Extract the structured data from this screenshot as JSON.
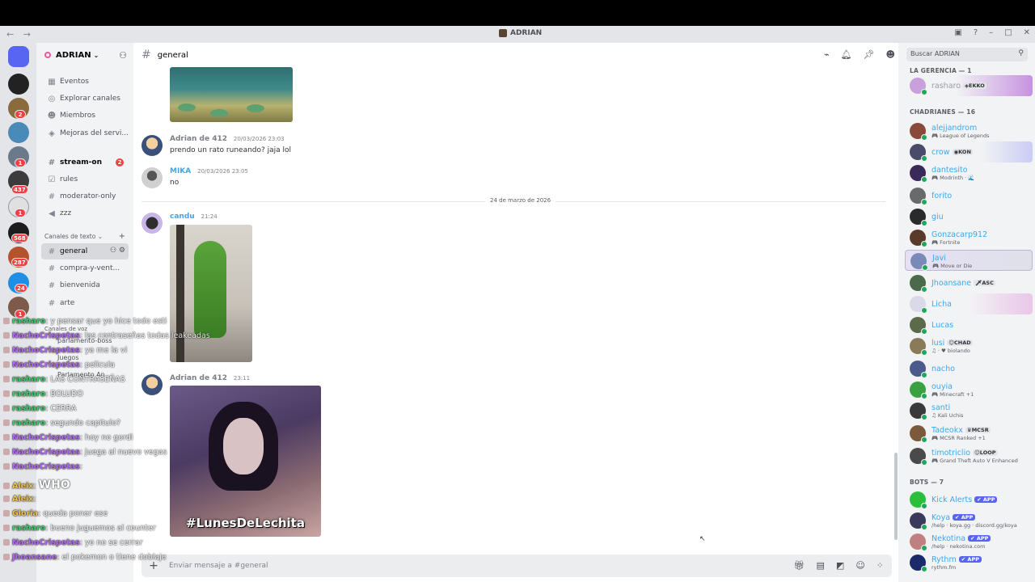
{
  "window": {
    "title": "ADRIAN",
    "nav": "← →"
  },
  "colors": {
    "accent": "#5865f2",
    "online": "#23a55a",
    "mention": "#f23f43",
    "link_name": "#3ea7ec"
  },
  "rail": {
    "badges": [
      "2",
      "1",
      "437",
      "1",
      "568",
      "287",
      "24",
      "1"
    ]
  },
  "sidebar": {
    "guild_name": "ADRIAN",
    "items": [
      {
        "icon": "calendar-icon",
        "glyph": "▦",
        "label": "Eventos"
      },
      {
        "icon": "compass-icon",
        "glyph": "◎",
        "label": "Explorar canales"
      },
      {
        "icon": "members-icon",
        "glyph": "☻",
        "label": "Miembros"
      },
      {
        "icon": "boost-icon",
        "glyph": "◈",
        "label": "Mejoras del servi..."
      },
      {
        "icon": "hash-icon",
        "glyph": "#",
        "label": "stream-on",
        "badge": "2"
      },
      {
        "icon": "rules-icon",
        "glyph": "☑",
        "label": "rules"
      },
      {
        "icon": "hash-icon",
        "glyph": "#",
        "label": "moderator-only"
      },
      {
        "icon": "speaker-icon",
        "glyph": "◀",
        "label": "zzz"
      },
      {
        "icon": "hash-icon",
        "glyph": "#",
        "label": "general"
      },
      {
        "icon": "hash-icon",
        "glyph": "#",
        "label": "compra-y-vent..."
      },
      {
        "icon": "hash-icon",
        "glyph": "#",
        "label": "bienvenida"
      },
      {
        "icon": "hash-icon",
        "glyph": "#",
        "label": "arte"
      }
    ],
    "category": "Canales de texto",
    "category_chevron": "⌄",
    "plus": "+"
  },
  "overlay": {
    "lines": [
      {
        "nick": "rasharo",
        "color": "g",
        "text": "y pensar que yo hice todo esti"
      },
      {
        "nick": "NachoCrispetas",
        "color": "p",
        "text": "las contraseñas todas leakeadas"
      },
      {
        "nick": "NachoCrispetas",
        "color": "p",
        "text": "ya me la vi"
      },
      {
        "nick": "NachoCrispetas",
        "color": "p",
        "text": "pelicula"
      },
      {
        "nick": "rasharo",
        "color": "g",
        "text": "LAS CONTRASEÑAS"
      },
      {
        "nick": "rasharo",
        "color": "g",
        "text": "BOLUDO"
      },
      {
        "nick": "rasharo",
        "color": "g",
        "text": "CERRA"
      },
      {
        "nick": "rasharo",
        "color": "g",
        "text": "segundo capitulo?"
      },
      {
        "nick": "NachoCrispetas",
        "color": "p",
        "text": "hoy no gordi"
      },
      {
        "nick": "NachoCrispetas",
        "color": "p",
        "text": "juega al nuevo vegas"
      },
      {
        "nick": "NachoCrispetas",
        "color": "p",
        "text": ""
      },
      {
        "nick": "Aleix",
        "color": "y",
        "text": "WHO"
      },
      {
        "nick": "Aleix",
        "color": "y",
        "text": ""
      },
      {
        "nick": "Gloria",
        "color": "y",
        "text": "queda poner ese"
      },
      {
        "nick": "rasharo",
        "color": "g",
        "text": "bueno juguemos al counter"
      },
      {
        "nick": "NachoCrispetas",
        "color": "p",
        "text": "yo no se cerrar"
      },
      {
        "nick": "Jhoansane",
        "color": "p",
        "text": "el pokemon o tiene doblaje"
      }
    ],
    "ghost": [
      "Canales de voz",
      "parlamento-boss",
      "Juegos",
      "Parlamento An..."
    ]
  },
  "channel": {
    "name": "general",
    "composer_placeholder": "Enviar mensaje a #general",
    "date_divider": "24 de marzo de 2026"
  },
  "messages": [
    {
      "author": "Adrian de 412",
      "time": "20/03/2026 23:03",
      "text": "prendo un rato runeando? jaja lol"
    },
    {
      "author": "MIKA",
      "time": "20/03/2026 23:05",
      "text": "no"
    },
    {
      "author": "candu",
      "time": "21:24",
      "text": ""
    },
    {
      "author": "Adrian de 412",
      "time": "23:11",
      "text": ""
    }
  ],
  "image_caption": "#LunesDeLechita",
  "members": {
    "search_placeholder": "Buscar ADRIAN",
    "groups": [
      {
        "label": "LA GERENCIA — 1"
      },
      {
        "label": "CHADRIANES — 16"
      },
      {
        "label": "BOTS — 7"
      }
    ],
    "list": [
      {
        "name": "rasharo",
        "tag": "◈EKKO",
        "activity": "",
        "style": "hl4",
        "gray": true
      },
      {
        "name": "alejjandrom",
        "tag": "",
        "activity": "🎮 League of Legends"
      },
      {
        "name": "crow",
        "tag": "◉KON",
        "activity": "",
        "style": "hl"
      },
      {
        "name": "dantesito",
        "tag": "",
        "activity": "🎮 Modrinth · 🌊"
      },
      {
        "name": "forito",
        "tag": "",
        "activity": ""
      },
      {
        "name": "giu",
        "tag": "",
        "activity": ""
      },
      {
        "name": "Gonzacarp912",
        "tag": "",
        "activity": "🎮 Fortnite"
      },
      {
        "name": "Javi",
        "tag": "",
        "activity": "🎮 Move or Die",
        "style": "hl2"
      },
      {
        "name": "Jhoansane",
        "tag": "🗡ASC",
        "activity": ""
      },
      {
        "name": "Licha",
        "tag": "",
        "activity": "",
        "style": "hl3"
      },
      {
        "name": "Lucas",
        "tag": "",
        "activity": ""
      },
      {
        "name": "lusi",
        "tag": "☺CHAD",
        "activity": "♫ · ♥ biolando"
      },
      {
        "name": "nacho",
        "tag": "",
        "activity": ""
      },
      {
        "name": "ouyia",
        "tag": "",
        "activity": "🎮 Minecraft +1"
      },
      {
        "name": "santi",
        "tag": "",
        "activity": "♫ Kali Uchis"
      },
      {
        "name": "Tadeokx",
        "tag": "♛MCSR",
        "activity": "🎮 MCSR Ranked +1"
      },
      {
        "name": "timotriclio",
        "tag": "☺LOOP",
        "activity": "🎮 Grand Theft Auto V Enhanced"
      },
      {
        "name": "Kick Alerts",
        "tag": "",
        "app": "✔ APP",
        "activity": ""
      },
      {
        "name": "Koya",
        "tag": "",
        "app": "✔ APP",
        "activity": "/help · koya.gg · discord.gg/koya"
      },
      {
        "name": "Nekotina",
        "tag": "",
        "app": "✔ APP",
        "activity": "/help · nekotina.com"
      },
      {
        "name": "Rythm",
        "tag": "",
        "app": "✔ APP",
        "activity": "rythm.fm"
      }
    ]
  }
}
